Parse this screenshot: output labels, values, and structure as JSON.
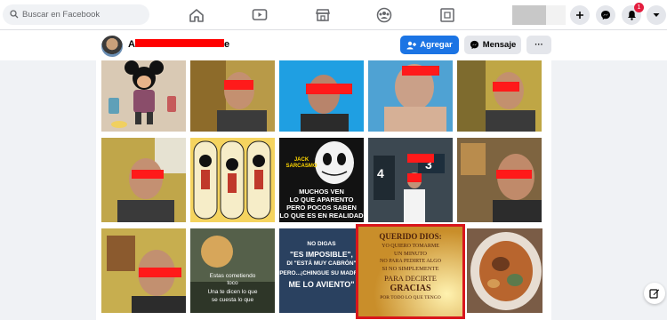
{
  "search": {
    "placeholder": "Buscar en Facebook"
  },
  "nav": {
    "icons": [
      "home-icon",
      "watch-icon",
      "marketplace-icon",
      "groups-icon",
      "gaming-icon"
    ]
  },
  "header_right": {
    "notification_count": "1",
    "icons": [
      "plus-icon",
      "messenger-icon",
      "bell-icon",
      "caret-down-icon"
    ]
  },
  "profile": {
    "name": "A",
    "name_suffix": "e",
    "add_button": "Agregar",
    "message_button": "Mensaje",
    "more_button": "···"
  },
  "tiles": {
    "jack_title": "JACK\nSARCASMO",
    "jack_text": "MUCHOS VEN\nLO QUE APARENTO\nPERO POCOS SABEN\nLO QUE ES EN REALIDAD",
    "impossible_text1": "NO DIGAS",
    "impossible_text2": "\"ES IMPOSIBLE\",",
    "impossible_text3": "DI \"ESTÁ MUY CABRÓN\"",
    "impossible_text4": "PERO...¡CHINGUE SU MADRE!",
    "impossible_text5": "ME LO AVIENTO\"",
    "dios_title": "QUERIDO DIOS:",
    "dios_line1": "YO QUIERO TOMARME",
    "dios_line2": "UN MINUTO",
    "dios_line3": "NO PARA PEDIRTE ALGO",
    "dios_line4": "SI NO SIMPLEMENTE",
    "dios_line5": "PARA DECIRTE",
    "dios_line6": "GRACIAS",
    "dios_line7": "POR TODO LO QUE TENGO",
    "sunset_text1": "Estas cometiendo",
    "sunset_text2": "toco",
    "sunset_text3": "Una te dicen lo que",
    "sunset_text4": "se cuesta lo que"
  },
  "colors": {
    "brand_blue": "#1b74e4",
    "redaction": "#ff0000",
    "highlight": "#d9161c"
  }
}
